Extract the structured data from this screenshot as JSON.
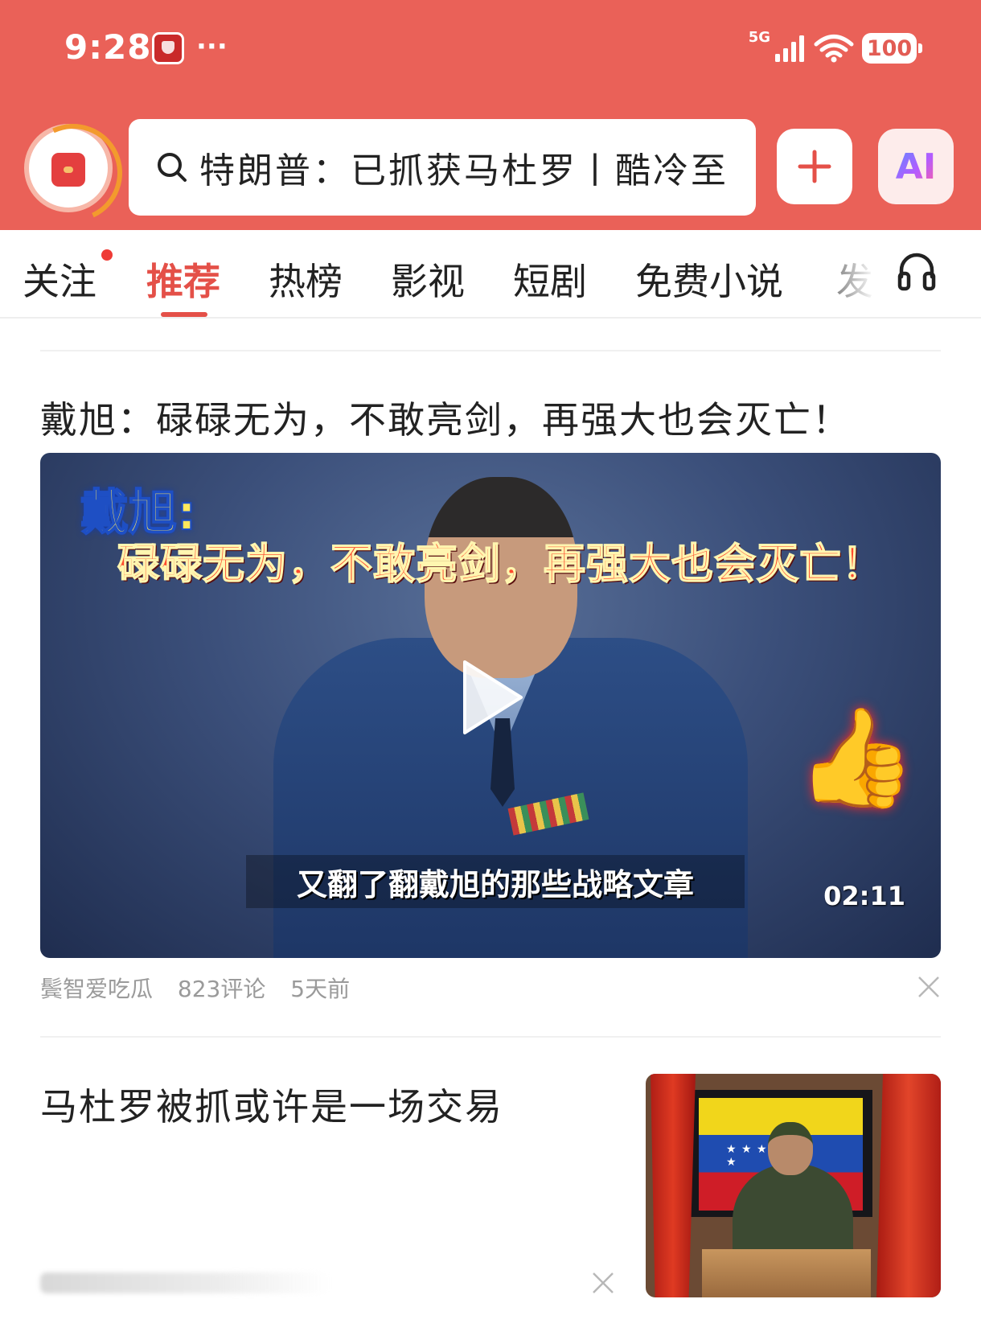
{
  "status_bar": {
    "time": "9:28",
    "dots": "···",
    "network": "5G",
    "battery": "100",
    "icons": [
      "app-notification-icon",
      "signal-icon",
      "wifi-icon",
      "battery-icon"
    ]
  },
  "header": {
    "search_query": "特朗普：已抓获马杜罗丨酷冷至",
    "ai_label": "AI",
    "icons": [
      "app-logo-icon",
      "search-icon",
      "plus-icon"
    ]
  },
  "tabs": [
    {
      "label": "关注",
      "active": false,
      "has_dot": true
    },
    {
      "label": "推荐",
      "active": true
    },
    {
      "label": "热榜",
      "active": false
    },
    {
      "label": "影视",
      "active": false
    },
    {
      "label": "短剧",
      "active": false
    },
    {
      "label": "免费小说",
      "active": false
    },
    {
      "label": "发",
      "active": false
    }
  ],
  "feed": [
    {
      "title": "戴旭：碌碌无为，不敢亮剑，再强大也会灭亡！",
      "video": {
        "overlay_name": "戴旭:",
        "overlay_quote": "碌碌无为，不敢亮剑，再强大也会灭亡！",
        "subtitle": "又翻了翻戴旭的那些战略文章",
        "duration": "02:11"
      },
      "meta": {
        "author": "鬓智爱吃瓜",
        "comments": "823评论",
        "time": "5天前"
      }
    },
    {
      "title": "马杜罗被抓或许是一场交易"
    }
  ],
  "colors": {
    "header_red": "#ea6158",
    "accent_red": "#e45048",
    "meta_gray": "#9a9a9a"
  }
}
